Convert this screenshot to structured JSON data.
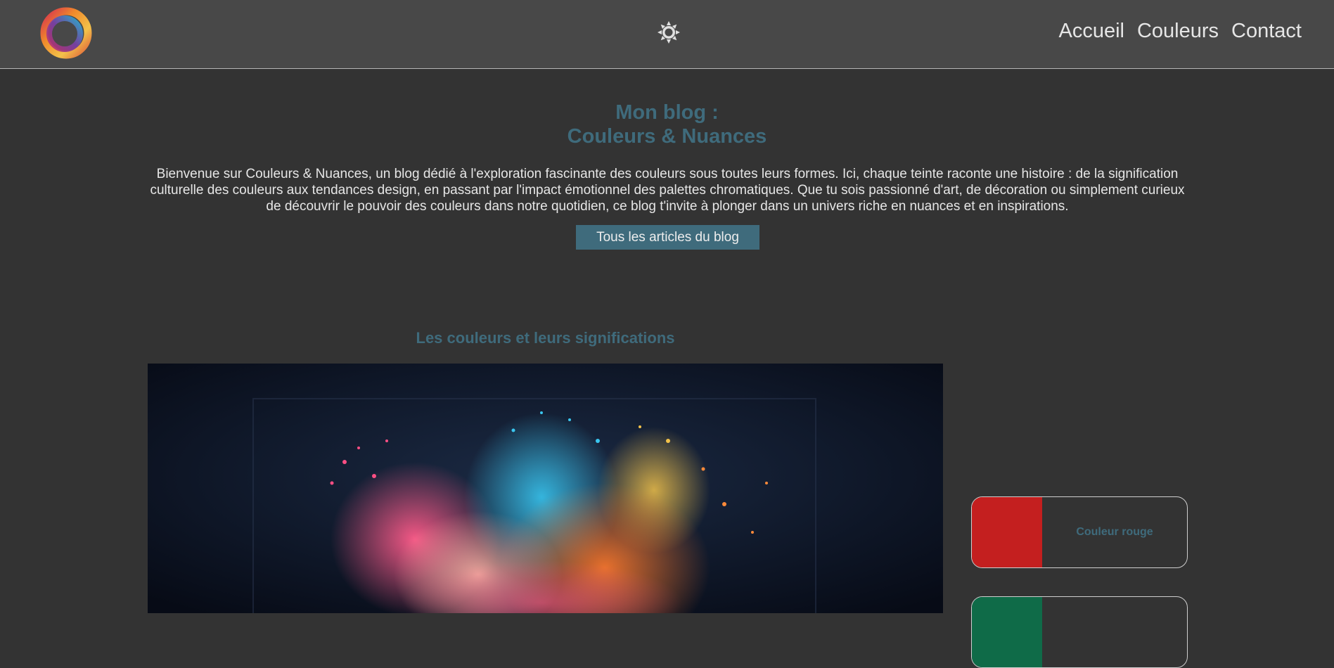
{
  "header": {
    "logo_icon": "logo-ring-icon",
    "theme_icon": "sun-icon",
    "nav": [
      {
        "label": "Accueil"
      },
      {
        "label": "Couleurs"
      },
      {
        "label": "Contact"
      }
    ]
  },
  "hero": {
    "title_line1": "Mon blog :",
    "title_line2": "Couleurs & Nuances",
    "description": "Bienvenue sur Couleurs & Nuances, un blog dédié à l'exploration fascinante des couleurs sous toutes leurs formes. Ici, chaque teinte raconte une histoire : de la signification culturelle des couleurs aux tendances design, en passant par l'impact émotionnel des palettes chromatiques. Que tu sois passionné d'art, de décoration ou simplement curieux de découvrir le pouvoir des couleurs dans notre quotidien, ce blog t'invite à plonger dans un univers riche en nuances et en inspirations.",
    "button_label": "Tous les articles du blog"
  },
  "featured": {
    "title": "Les couleurs et leurs significations"
  },
  "color_cards": [
    {
      "label": "Couleur rouge",
      "swatch_color": "#c41f1f"
    },
    {
      "label": "",
      "swatch_color": "#0f6b48"
    }
  ],
  "colors": {
    "accent": "#3f6b7c",
    "header_bg": "#484848",
    "page_bg": "#333333"
  }
}
